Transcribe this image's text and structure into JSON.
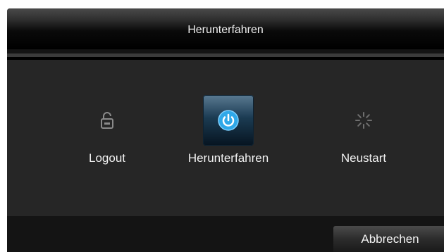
{
  "dialog": {
    "title": "Herunterfahren"
  },
  "options": [
    {
      "label": "Logout",
      "icon": "padlock-icon",
      "selected": false
    },
    {
      "label": "Herunterfahren",
      "icon": "power-icon",
      "selected": true
    },
    {
      "label": "Neustart",
      "icon": "spinner-icon",
      "selected": false
    }
  ],
  "footer": {
    "cancel_label": "Abbrechen"
  },
  "colors": {
    "selected_icon": "#2fa8e8",
    "dim_icon": "#8a8a8a"
  }
}
